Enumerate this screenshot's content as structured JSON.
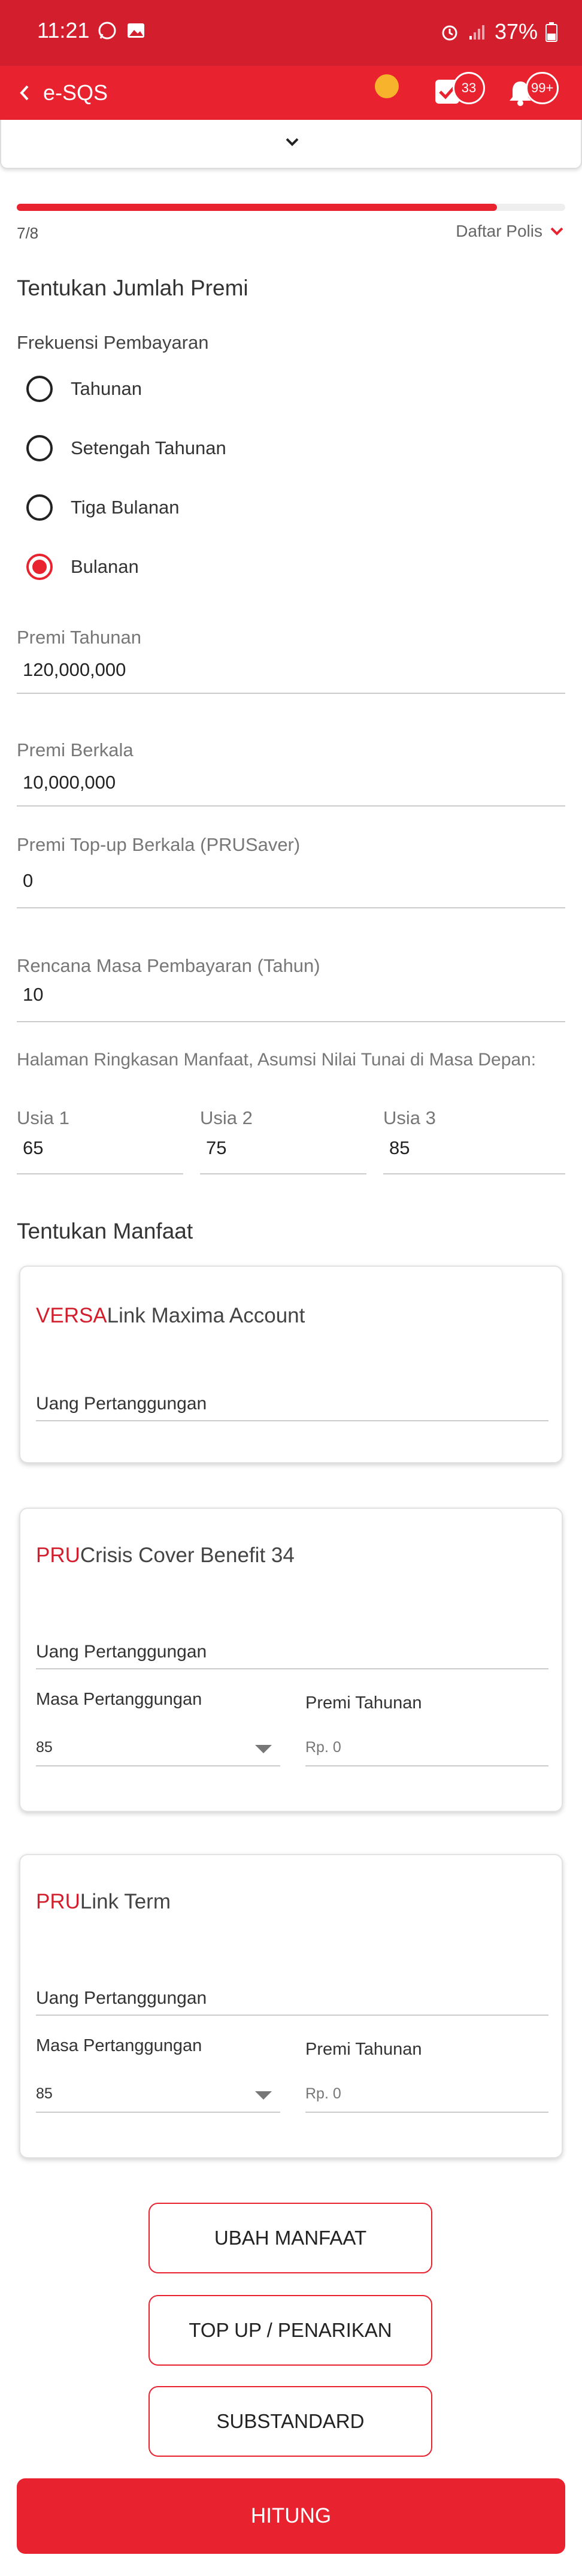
{
  "status_bar": {
    "time": "11:21",
    "battery": "37%"
  },
  "app_bar": {
    "title": "e-SQS",
    "tasks_badge": "33",
    "notifications_badge": "99+"
  },
  "progress": {
    "step": "7/8",
    "fraction": 0.875,
    "daftar_polis": "Daftar Polis"
  },
  "premium": {
    "heading": "Tentukan Jumlah Premi",
    "frequency_label": "Frekuensi Pembayaran",
    "options": [
      "Tahunan",
      "Setengah Tahunan",
      "Tiga Bulanan",
      "Bulanan"
    ],
    "selected": "Bulanan"
  },
  "fields": {
    "premi_tahunan": {
      "label": "Premi Tahunan",
      "value": "120,000,000"
    },
    "premi_berkala": {
      "label": "Premi Berkala",
      "value": "10,000,000"
    },
    "premi_topup": {
      "label": "Premi Top-up Berkala (PRUSaver)",
      "value": "0"
    },
    "masa_pembayaran": {
      "label": "Rencana Masa Pembayaran (Tahun)",
      "value": "10"
    }
  },
  "summary": {
    "label": "Halaman Ringkasan Manfaat, Asumsi Nilai Tunai di Masa Depan:",
    "ages": [
      {
        "label": "Usia 1",
        "value": "65"
      },
      {
        "label": "Usia 2",
        "value": "75"
      },
      {
        "label": "Usia 3",
        "value": "85"
      }
    ]
  },
  "benefits": {
    "heading": "Tentukan Manfaat",
    "cards": [
      {
        "brand": "VERSA",
        "name": "Link Maxima Account",
        "sum_label": "Uang Pertanggungan"
      },
      {
        "brand": "PRU",
        "name": "Crisis Cover Benefit 34",
        "sum_label": "Uang Pertanggungan",
        "term_label": "Masa Pertanggungan",
        "term_value": "85",
        "premium_label": "Premi Tahunan",
        "premium_value": "Rp. 0"
      },
      {
        "brand": "PRU",
        "name": "Link Term",
        "sum_label": "Uang Pertanggungan",
        "term_label": "Masa Pertanggungan",
        "term_value": "85",
        "premium_label": "Premi Tahunan",
        "premium_value": "Rp. 0"
      }
    ]
  },
  "buttons": {
    "ubah_manfaat": "UBAH MANFAAT",
    "top_up": "TOP UP / PENARIKAN",
    "substandard": "SUBSTANDARD",
    "hitung": "HITUNG"
  },
  "colors": {
    "primary": "#e8232f",
    "status_bar": "#d31f2d",
    "accent_dot": "#f7b32b"
  }
}
